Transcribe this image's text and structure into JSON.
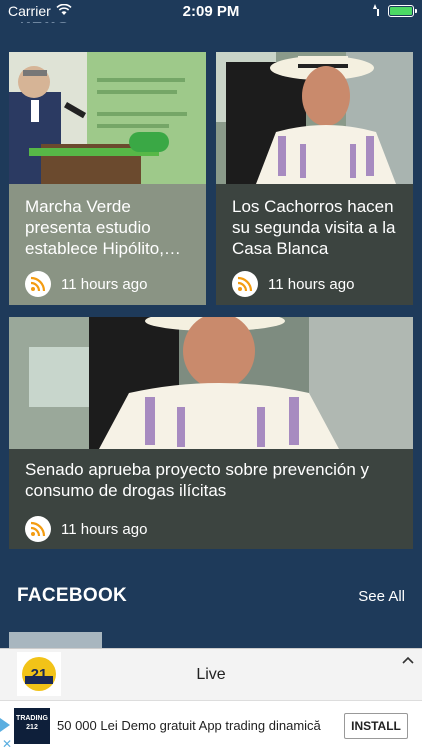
{
  "status_bar": {
    "carrier": "Carrier",
    "time": "2:09 PM"
  },
  "header": {
    "ghost_title": "NEWS"
  },
  "articles": [
    {
      "title": "Marcha Verde presenta estudio establece Hipólito,…",
      "time": "11 hours ago"
    },
    {
      "title": "Los Cachorros hacen su segunda visita a la Casa Blanca",
      "time": "11 hours ago"
    },
    {
      "title": "Senado aprueba proyecto sobre prevención y consumo de drogas ilícitas",
      "time": "11 hours ago"
    }
  ],
  "facebook": {
    "title": "FACEBOOK",
    "see_all": "See All"
  },
  "live_bar": {
    "logo_text": "21",
    "label": "Live"
  },
  "ad": {
    "logo_text": "TRADING 212",
    "text": "50 000 Lei Demo gratuit App trading dinamică",
    "install": "INSTALL"
  },
  "colors": {
    "background": "#1e3a5a",
    "card": "#3c4440",
    "rss": "#f39c12",
    "battery": "#4cd964"
  },
  "icons": [
    "wifi-icon",
    "battery-icon",
    "rss-icon",
    "chevron-up-icon",
    "ad-play-icon",
    "close-icon"
  ]
}
